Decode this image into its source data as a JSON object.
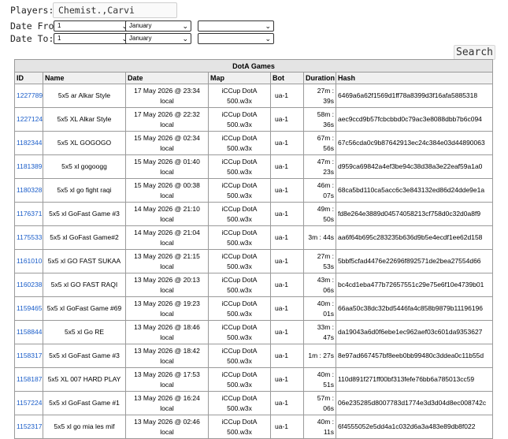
{
  "form": {
    "players_label": "Players:",
    "players_value": "Chemist.,Carvi",
    "date_from_label": "Date From:",
    "date_to_label": "Date To:",
    "from": {
      "day": "1",
      "month": "January",
      "year": ""
    },
    "to": {
      "day": "1",
      "month": "January",
      "year": ""
    },
    "search_label": "Search"
  },
  "table": {
    "caption": "DotA Games",
    "headers": [
      "ID",
      "Name",
      "Date",
      "Map",
      "Bot",
      "Duration",
      "Hash"
    ],
    "rows": [
      {
        "id": "1227789",
        "name": "5x5 ar Alkar Style",
        "date": "17 May 2026 @ 23:34",
        "tz": "local",
        "map": "iCCup DotA",
        "map_file": "500.w3x",
        "bot": "ua-1",
        "duration": "27m : 39s",
        "hash": "6469a6a62f1569d1ff78a8399d3f16afa5885318"
      },
      {
        "id": "1227124",
        "name": "5x5 XL Alkar Style",
        "date": "17 May 2026 @ 22:32",
        "tz": "local",
        "map": "iCCup DotA",
        "map_file": "500.w3x",
        "bot": "ua-1",
        "duration": "58m : 36s",
        "hash": "aec9ccd9b57fcbcbbd0c79ac3e8088dbb7b6c094"
      },
      {
        "id": "1182344",
        "name": "5x5 XL GOGOGO",
        "date": "15 May 2026 @ 02:34",
        "tz": "local",
        "map": "iCCup DotA",
        "map_file": "500.w3x",
        "bot": "ua-1",
        "duration": "67m : 56s",
        "hash": "67c56cda0c9b87642913ec24c384e03d44890063"
      },
      {
        "id": "1181389",
        "name": "5x5 xl gogoogg",
        "date": "15 May 2026 @ 01:40",
        "tz": "local",
        "map": "iCCup DotA",
        "map_file": "500.w3x",
        "bot": "ua-1",
        "duration": "47m : 23s",
        "hash": "d959ca69842a4ef3be94c38d38a3e22eaf59a1a0"
      },
      {
        "id": "1180328",
        "name": "5x5 xl go fight raqi",
        "date": "15 May 2026 @ 00:38",
        "tz": "local",
        "map": "iCCup DotA",
        "map_file": "500.w3x",
        "bot": "ua-1",
        "duration": "46m : 07s",
        "hash": "68ca5bd110ca5acc6c3e843132ed86d24dde9e1a"
      },
      {
        "id": "1176371",
        "name": "5x5 xl GoFast Game #3",
        "date": "14 May 2026 @ 21:10",
        "tz": "local",
        "map": "iCCup DotA",
        "map_file": "500.w3x",
        "bot": "ua-1",
        "duration": "49m : 50s",
        "hash": "fd8e264e3889d04574058213cf758d0c32d0a8f9"
      },
      {
        "id": "1175533",
        "name": "5x5 xl GoFast Game#2",
        "date": "14 May 2026 @ 21:04",
        "tz": "local",
        "map": "iCCup DotA",
        "map_file": "500.w3x",
        "bot": "ua-1",
        "duration": "3m : 44s",
        "hash": "aa6f64b695c283235b636d9b5e4ecdf1ee62d158"
      },
      {
        "id": "1161010",
        "name": "5x5 xl GO FAST SUKAA",
        "date": "13 May 2026 @ 21:15",
        "tz": "local",
        "map": "iCCup DotA",
        "map_file": "500.w3x",
        "bot": "ua-1",
        "duration": "27m : 53s",
        "hash": "5bbf5cfad4476e22696f892571de2bea27554d66"
      },
      {
        "id": "1160238",
        "name": "5x5 xl GO FAST RAQI",
        "date": "13 May 2026 @ 20:13",
        "tz": "local",
        "map": "iCCup DotA",
        "map_file": "500.w3x",
        "bot": "ua-1",
        "duration": "43m : 06s",
        "hash": "bc4cd1eba477b72657551c29e75e6f10e4739b01"
      },
      {
        "id": "1159465",
        "name": "5x5 xl GoFast Game #69",
        "date": "13 May 2026 @ 19:23",
        "tz": "local",
        "map": "iCCup DotA",
        "map_file": "500.w3x",
        "bot": "ua-1",
        "duration": "40m : 01s",
        "hash": "66aa50c38dc32bd5446fa4c858b9879b11196196"
      },
      {
        "id": "1158844",
        "name": "5x5 xl Go RE",
        "date": "13 May 2026 @ 18:46",
        "tz": "local",
        "map": "iCCup DotA",
        "map_file": "500.w3x",
        "bot": "ua-1",
        "duration": "33m : 47s",
        "hash": "da19043a6d0f6ebe1ec962aef03c601da9353627"
      },
      {
        "id": "1158317",
        "name": "5x5 xl GoFast Game #3",
        "date": "13 May 2026 @ 18:42",
        "tz": "local",
        "map": "iCCup DotA",
        "map_file": "500.w3x",
        "bot": "ua-1",
        "duration": "1m : 27s",
        "hash": "8e97ad667457bf8eeb0bb99480c3ddea0c11b55d"
      },
      {
        "id": "1158187",
        "name": "5x5 XL 007 HARD PLAY",
        "date": "13 May 2026 @ 17:53",
        "tz": "local",
        "map": "iCCup DotA",
        "map_file": "500.w3x",
        "bot": "ua-1",
        "duration": "40m : 51s",
        "hash": "110d891f271ff00bf313fefe76bb6a785013cc59"
      },
      {
        "id": "1157224",
        "name": "5x5 xl GoFast Game #1",
        "date": "13 May 2026 @ 16:24",
        "tz": "local",
        "map": "iCCup DotA",
        "map_file": "500.w3x",
        "bot": "ua-1",
        "duration": "57m : 06s",
        "hash": "06e235285d8007783d1774e3d3d04d8ec008742c"
      },
      {
        "id": "1152317",
        "name": "5x5 xl go mia les mif",
        "date": "13 May 2026 @ 02:46",
        "tz": "local",
        "map": "iCCup DotA",
        "map_file": "500.w3x",
        "bot": "ua-1",
        "duration": "40m : 11s",
        "hash": "6f4555052e5dd4a1c032d6a3a483e89db8f022"
      }
    ]
  }
}
